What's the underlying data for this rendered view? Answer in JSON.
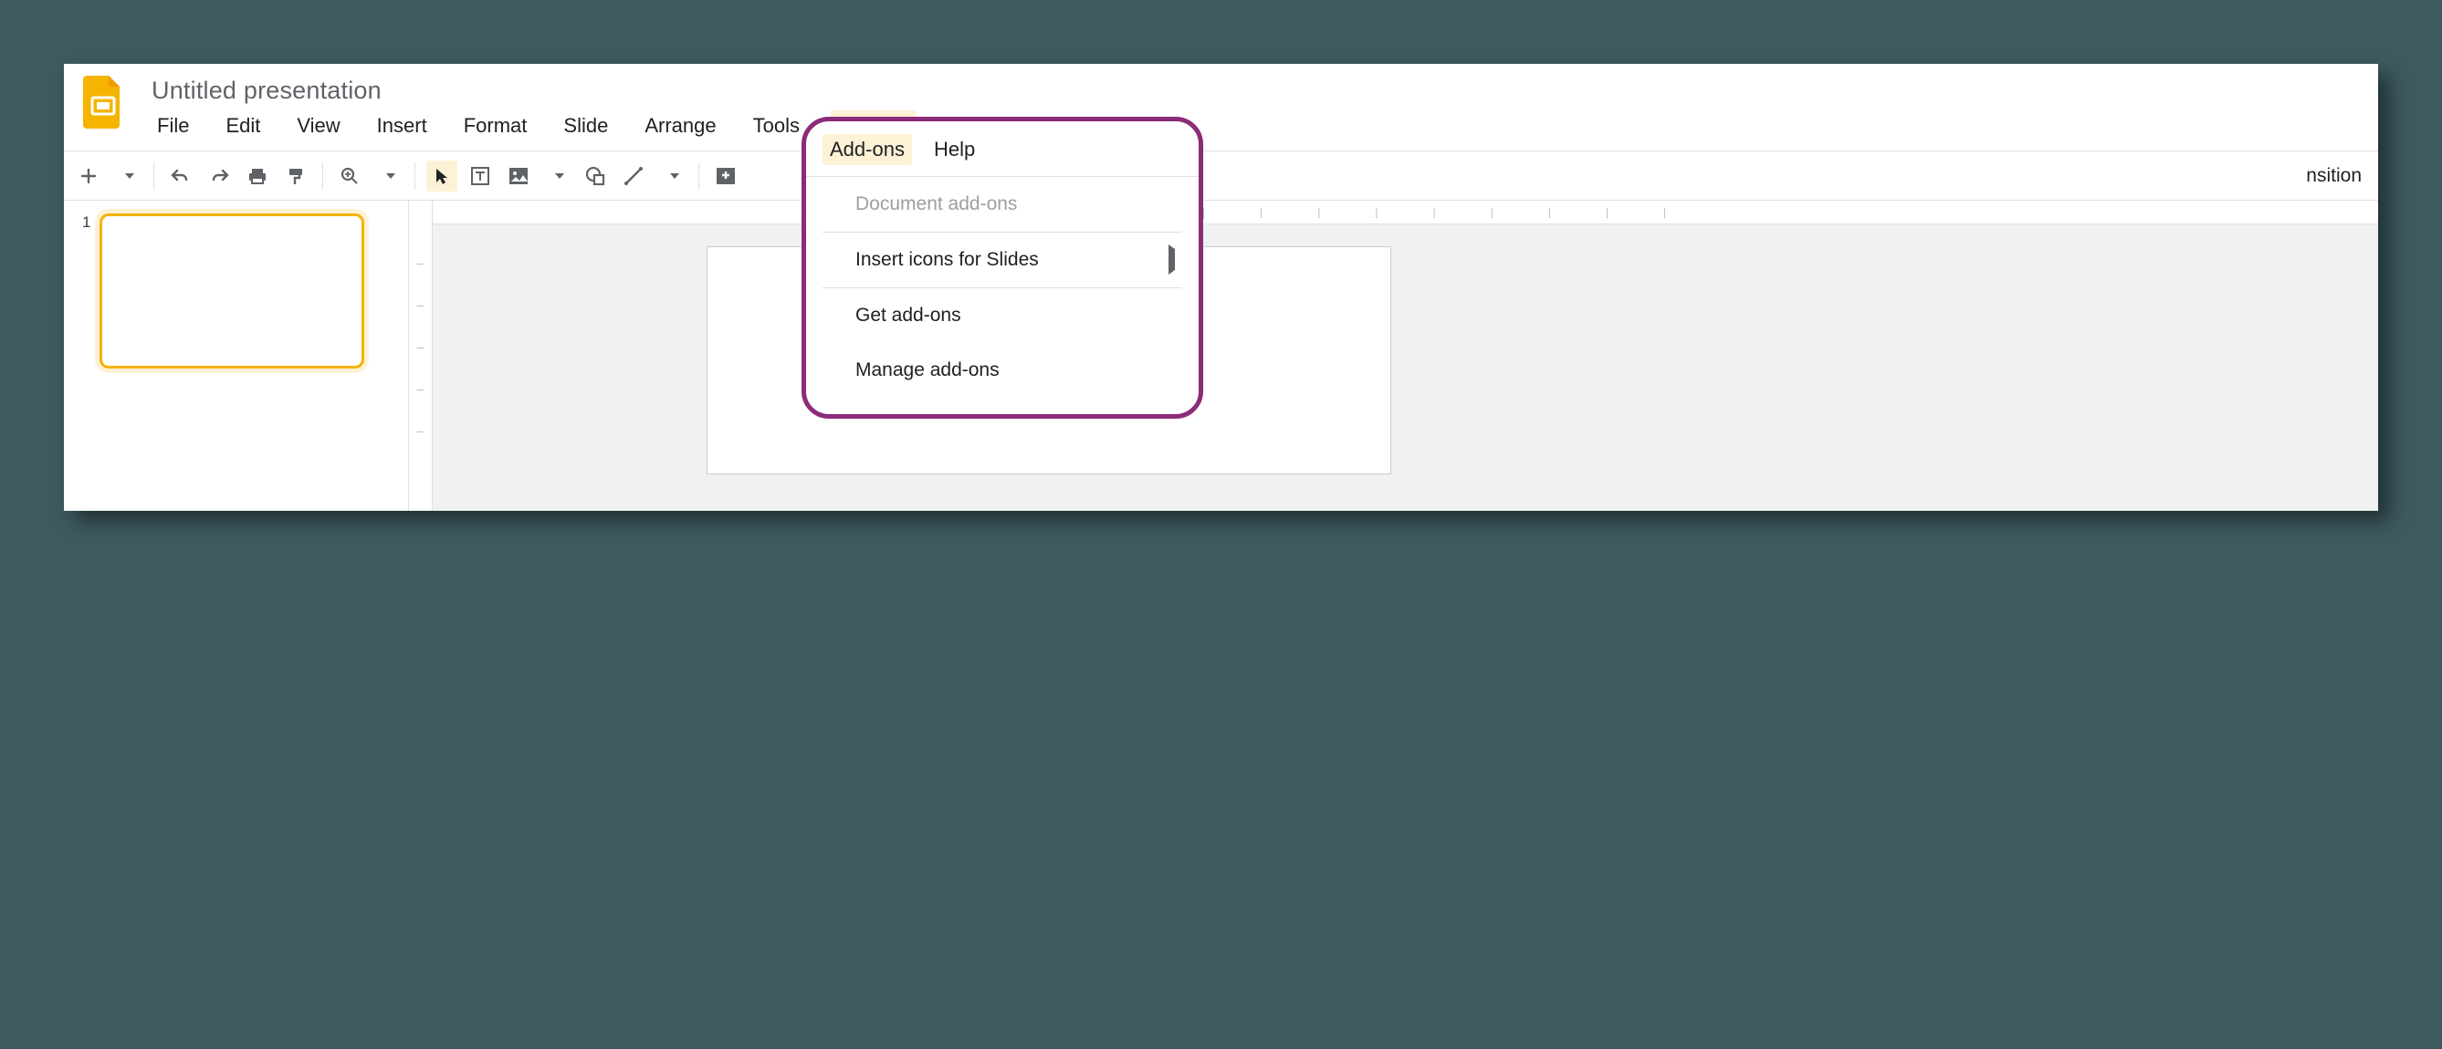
{
  "header": {
    "doc_title": "Untitled presentation",
    "menus": [
      "File",
      "Edit",
      "View",
      "Insert",
      "Format",
      "Slide",
      "Arrange",
      "Tools",
      "Add-ons",
      "Help"
    ],
    "active_menu": "Add-ons"
  },
  "toolbar": {
    "right_label": "nsition"
  },
  "thumbs": {
    "number": "1"
  },
  "dropdown": {
    "tabs": [
      "Add-ons",
      "Help"
    ],
    "active_tab": "Add-ons",
    "disabled_label": "Document add-ons",
    "submenu_label": "Insert icons for Slides",
    "get_label": "Get add-ons",
    "manage_label": "Manage add-ons"
  }
}
